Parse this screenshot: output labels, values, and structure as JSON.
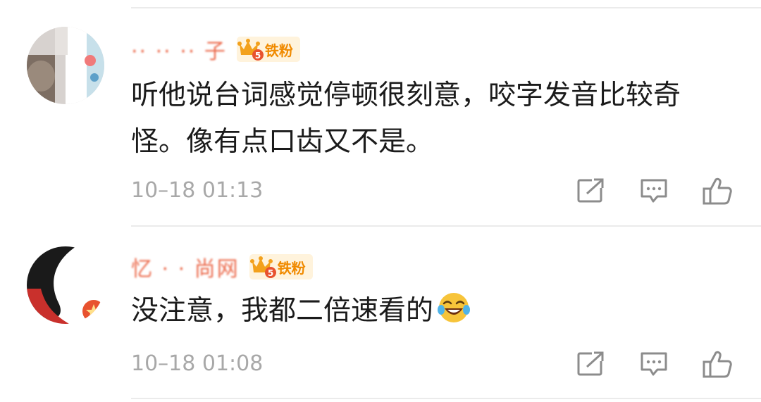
{
  "comments": [
    {
      "username": "·· ·· ·· 子",
      "badge": {
        "label": "铁粉",
        "level": "5"
      },
      "text": "听他说台词感觉停顿很刻意，咬字发音比较奇怪。像有点口齿又不是。",
      "timestamp": "10–18 01:13",
      "actions": [
        "share-icon",
        "comment-icon",
        "like-icon"
      ]
    },
    {
      "username": "忆 · · 尚网",
      "badge": {
        "label": "铁粉",
        "level": "5"
      },
      "text": "没注意，我都二倍速看的",
      "emoji": "laugh-cry-emoji",
      "timestamp": "10–18 01:08",
      "actions": [
        "share-icon",
        "comment-icon",
        "like-icon"
      ]
    }
  ],
  "colors": {
    "badge_bg": "#fff3dc",
    "badge_text": "#f08a00",
    "timestamp": "#a8a8a8",
    "body_text": "#1b1b1b",
    "divider": "#ebebeb"
  }
}
